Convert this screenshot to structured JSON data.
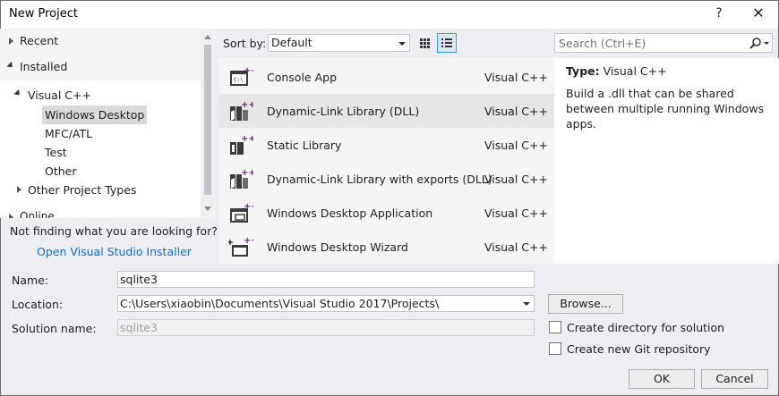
{
  "window": {
    "title": "New Project",
    "help_label": "?",
    "close_label": "✕"
  },
  "sidebar": {
    "recent": "Recent",
    "installed": "Installed",
    "visual_cpp": "Visual C++",
    "children": [
      "Windows Desktop",
      "MFC/ATL",
      "Test",
      "Other"
    ],
    "other_types": "Other Project Types",
    "online": "Online",
    "not_finding": "Not finding what you are looking for?",
    "installer_link": "Open Visual Studio Installer"
  },
  "sortbar": {
    "label": "Sort by:",
    "value": "Default"
  },
  "templates": [
    {
      "name": "Console App",
      "lang": "Visual C++",
      "icon": "console-app-icon"
    },
    {
      "name": "Dynamic-Link Library (DLL)",
      "lang": "Visual C++",
      "icon": "dll-icon"
    },
    {
      "name": "Static Library",
      "lang": "Visual C++",
      "icon": "static-library-icon"
    },
    {
      "name": "Dynamic-Link Library with exports (DLL)",
      "lang": "Visual C++",
      "icon": "dll-exports-icon"
    },
    {
      "name": "Windows Desktop Application",
      "lang": "Visual C++",
      "icon": "desktop-app-icon"
    },
    {
      "name": "Windows Desktop Wizard",
      "lang": "Visual C++",
      "icon": "wizard-icon"
    }
  ],
  "search": {
    "placeholder": "Search (Ctrl+E)"
  },
  "details": {
    "type_label": "Type:",
    "type_value": "Visual C++",
    "description": "Build a .dll that can be shared between multiple running Windows apps."
  },
  "form": {
    "name_label": "Name:",
    "name_value": "sqlite3",
    "location_label": "Location:",
    "location_value": "C:\\Users\\xiaobin\\Documents\\Visual Studio 2017\\Projects\\",
    "solution_label": "Solution name:",
    "solution_value": "sqlite3",
    "browse": "Browse...",
    "create_dir": "Create directory for solution",
    "create_git": "Create new Git repository",
    "ok": "OK",
    "cancel": "Cancel"
  },
  "colors": {
    "accent": "#3399ff",
    "link": "#0e70c0",
    "selected_row": "#e6e6e6",
    "icon_purple": "#68217a"
  }
}
